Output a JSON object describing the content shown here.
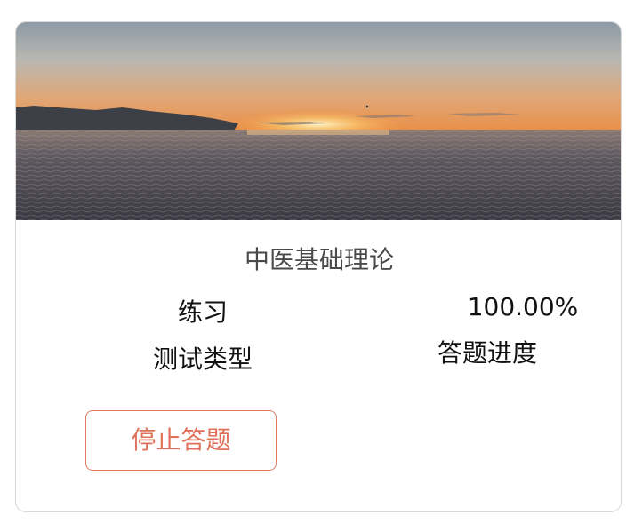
{
  "course": {
    "title": "中医基础理论",
    "cover_image": "sunset-over-sea"
  },
  "stats": {
    "test_type_value": "练习",
    "test_type_label": "测试类型",
    "progress_value": "100.00%",
    "progress_label": "答题进度"
  },
  "actions": {
    "stop_label": "停止答题"
  },
  "colors": {
    "accent": "#e0705a",
    "card_border": "#d9d9d9",
    "title_text": "#4a4a4a"
  }
}
